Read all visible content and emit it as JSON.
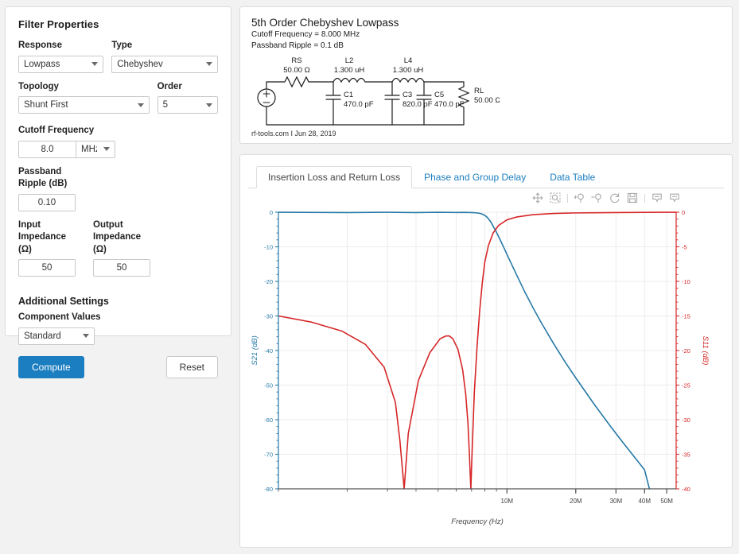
{
  "sidebar": {
    "title": "Filter Properties",
    "response": {
      "label": "Response",
      "value": "Lowpass"
    },
    "type": {
      "label": "Type",
      "value": "Chebyshev"
    },
    "topology": {
      "label": "Topology",
      "value": "Shunt First"
    },
    "order": {
      "label": "Order",
      "value": "5"
    },
    "cutoff": {
      "label": "Cutoff Frequency",
      "value": "8.0",
      "unit": "MHz"
    },
    "ripple": {
      "label": "Passband\nRipple (dB)",
      "label_line1": "Passband",
      "label_line2": "Ripple (dB)",
      "value": "0.10"
    },
    "input_impedance": {
      "label_line1": "Input",
      "label_line2": "Impedance (Ω)",
      "value": "50"
    },
    "output_impedance": {
      "label_line1": "Output",
      "label_line2": "Impedance (Ω)",
      "value": "50"
    },
    "additional_settings_title": "Additional Settings",
    "component_values": {
      "label": "Component Values",
      "value": "Standard"
    },
    "compute_label": "Compute",
    "reset_label": "Reset",
    "accent": "#1b7ec0"
  },
  "schematic": {
    "title": "5th Order Chebyshev Lowpass",
    "cutoff_line": "Cutoff Frequency = 8.000 MHz",
    "ripple_line": "Passband Ripple = 0.1 dB",
    "footer": "rf-tools.com I Jun 28, 2019",
    "components": [
      {
        "ref": "RS",
        "value": "50.00 Ω"
      },
      {
        "ref": "L2",
        "value": "1.300 uH"
      },
      {
        "ref": "L4",
        "value": "1.300 uH"
      },
      {
        "ref": "C1",
        "value": "470.0 pF"
      },
      {
        "ref": "C3",
        "value": "820.0 pF"
      },
      {
        "ref": "C5",
        "value": "470.0 pF"
      },
      {
        "ref": "RL",
        "value": "50.00 Ω"
      }
    ]
  },
  "tabs": [
    {
      "label": "Insertion Loss and Return Loss",
      "active": true
    },
    {
      "label": "Phase and Group Delay",
      "active": false
    },
    {
      "label": "Data Table",
      "active": false
    }
  ],
  "toolbar": [
    {
      "name": "pan-icon",
      "title": "Pan"
    },
    {
      "name": "zoom-box-icon",
      "title": "Box Zoom"
    },
    {
      "name": "zoom-in-icon",
      "title": "Zoom In"
    },
    {
      "name": "zoom-out-icon",
      "title": "Zoom Out"
    },
    {
      "name": "reset-icon",
      "title": "Reset"
    },
    {
      "name": "save-icon",
      "title": "Save"
    },
    {
      "name": "hover-tool-icon",
      "title": "Hover"
    },
    {
      "name": "hover-tool-2-icon",
      "title": "Hover"
    }
  ],
  "chart_data": {
    "type": "line",
    "title": "",
    "xlabel": "Frequency (Hz)",
    "ylabel": "S21 (dB)",
    "y2label": "S11 (dB)",
    "xscale": "log",
    "xlim": [
      1000000,
      55000000
    ],
    "ylim": [
      -80,
      0
    ],
    "y2lim": [
      -40,
      0
    ],
    "xticks": [
      10000000,
      20000000,
      30000000,
      40000000,
      50000000
    ],
    "xticklabels": [
      "10M",
      "20M",
      "30M",
      "40M",
      "50M"
    ],
    "yticks": [
      0,
      -10,
      -20,
      -30,
      -40,
      -50,
      -60,
      -70,
      -80
    ],
    "yticklabels": [
      "0",
      "-10",
      "-20",
      "-30",
      "-40",
      "-50",
      "-60",
      "-70",
      "-80"
    ],
    "y2ticks": [
      0,
      -5,
      -10,
      -15,
      -20,
      -25,
      -30,
      -35,
      -40
    ],
    "y2ticklabels": [
      "0",
      "-5",
      "-10",
      "-15",
      "-20",
      "-25",
      "-30",
      "-35",
      "-40"
    ],
    "grid": true,
    "legend": "none",
    "series": [
      {
        "name": "S21 (dB)",
        "axis": "left",
        "color": "#2779a7",
        "x": [
          1000000,
          2000000,
          3000000,
          4000000,
          5000000,
          6000000,
          6500000,
          7000000,
          7400000,
          7700000,
          8000000,
          8200000,
          8500000,
          9000000,
          9500000,
          10000000,
          11000000,
          12000000,
          13000000,
          14000000,
          16000000,
          18000000,
          20000000,
          24000000,
          28000000,
          32000000,
          36000000,
          40000000,
          42000000
        ],
        "y": [
          -0.02,
          -0.1,
          -0.02,
          -0.09,
          -0.02,
          -0.08,
          -0.05,
          -0.1,
          -0.2,
          -0.4,
          -0.9,
          -1.5,
          -2.8,
          -5.8,
          -9.0,
          -12.2,
          -18.0,
          -23.2,
          -27.6,
          -31.5,
          -38.0,
          -43.4,
          -47.9,
          -55.4,
          -61.4,
          -66.4,
          -70.7,
          -74.5,
          -80.0
        ]
      },
      {
        "name": "S11 (dB)",
        "axis": "right",
        "color": "#d62728",
        "x": [
          1000000,
          1400000,
          1900000,
          2400000,
          2900000,
          3250000,
          3400000,
          3550000,
          3700000,
          4100000,
          4600000,
          5100000,
          5400000,
          5600000,
          5800000,
          6100000,
          6400000,
          6600000,
          6750000,
          6850000,
          6950000,
          7050000,
          7200000,
          7400000,
          7600000,
          7800000,
          8000000,
          8300000,
          8700000,
          9200000,
          10000000,
          11000000,
          13000000,
          16000000,
          20000000,
          30000000,
          40000000,
          50000000,
          55000000
        ],
        "y": [
          -15.0,
          -15.9,
          -17.2,
          -19.1,
          -22.4,
          -27.5,
          -33.0,
          -40.0,
          -32.0,
          -24.3,
          -20.3,
          -18.3,
          -17.9,
          -17.9,
          -18.3,
          -19.8,
          -22.8,
          -26.3,
          -30.5,
          -35.0,
          -40.0,
          -34.0,
          -26.0,
          -19.4,
          -14.2,
          -10.2,
          -7.2,
          -4.8,
          -3.0,
          -1.9,
          -1.1,
          -0.7,
          -0.35,
          -0.18,
          -0.1,
          -0.05,
          -0.02,
          -0.01,
          -0.01
        ]
      }
    ]
  }
}
